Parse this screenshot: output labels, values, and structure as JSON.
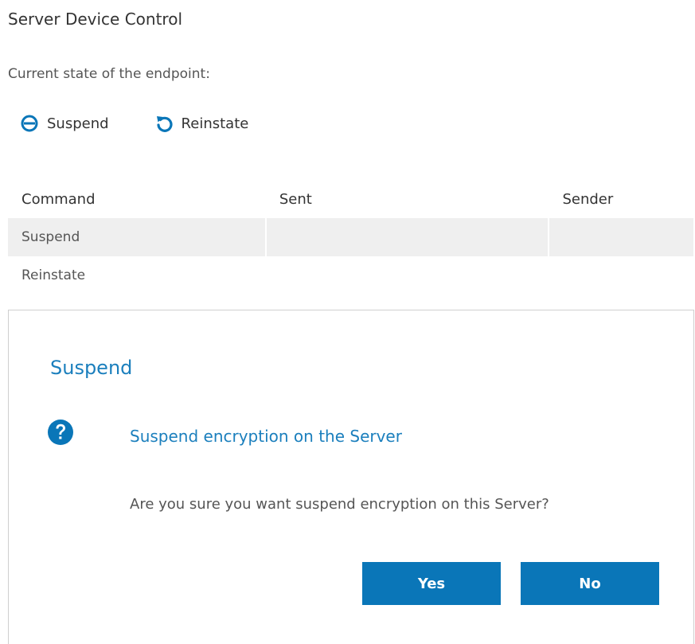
{
  "page": {
    "title": "Server Device Control",
    "state_label": "Current state of the endpoint:"
  },
  "actions": {
    "suspend": {
      "label": "Suspend",
      "icon": "minus-circle-icon"
    },
    "reinstate": {
      "label": "Reinstate",
      "icon": "undo-arrow-icon"
    }
  },
  "table": {
    "columns": [
      "Command",
      "Sent",
      "Sender"
    ],
    "rows": [
      {
        "command": "Suspend",
        "sent": "",
        "sender": ""
      },
      {
        "command": "Reinstate",
        "sent": "",
        "sender": ""
      }
    ]
  },
  "dialog": {
    "title": "Suspend",
    "icon": "question-circle-icon",
    "heading": "Suspend encryption on the Server",
    "message": "Are you sure you want suspend encryption on this Server?",
    "yes_label": "Yes",
    "no_label": "No"
  },
  "colors": {
    "accent": "#1b7fbd",
    "button": "#0a76b8",
    "stripe": "#efefef",
    "border": "#cfcfcf"
  }
}
